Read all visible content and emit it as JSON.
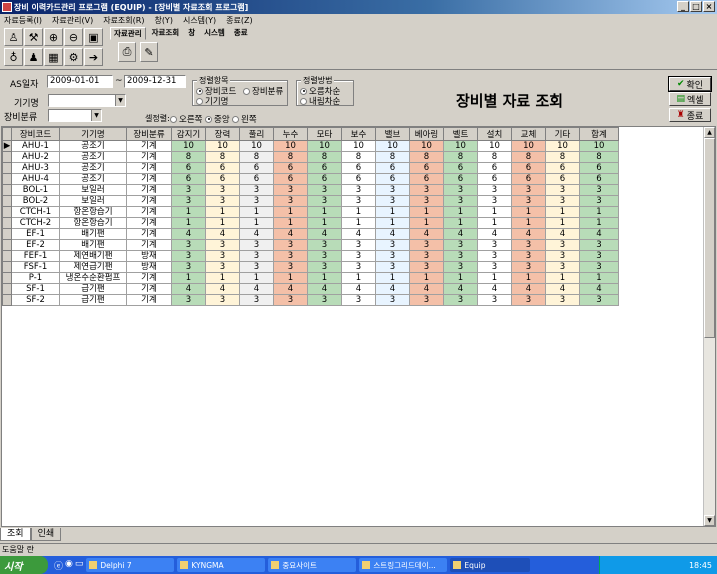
{
  "window": {
    "title": "장비 이력카드관리 프로그램 (EQUIP) - [장비별 자료조회 프로그램]"
  },
  "menu": [
    "자료등록(I)",
    "자료관리(V)",
    "자료조회(R)",
    "창(Y)",
    "시스템(Y)",
    "종료(Z)"
  ],
  "toolbar_tabs": [
    "자료관리",
    "자료조회",
    "창",
    "시스템",
    "종료"
  ],
  "filters": {
    "as_date_label": "AS일자",
    "date_from": "2009-01-01",
    "date_sep": "~",
    "date_to": "2009-12-31",
    "machine_name_label": "기기명",
    "machine_name_value": "",
    "category_label": "장비분류",
    "category_value": ""
  },
  "sort_item": {
    "title": "정렬항목",
    "options": [
      "장비코드",
      "장비분류",
      "기기명"
    ],
    "selected": "장비코드"
  },
  "sort_order": {
    "title": "정렬방법",
    "options": [
      "오름차순",
      "내림차순"
    ],
    "selected": "오름차순"
  },
  "alignment": {
    "label": "셀정렬:",
    "options": [
      "오른쪽",
      "중앙",
      "왼쪽"
    ],
    "selected": "중앙"
  },
  "page_title": "장비별 자료 조회",
  "buttons": {
    "confirm": "확인",
    "excel": "엑셀",
    "exit": "종료"
  },
  "table": {
    "columns": [
      "장비코드",
      "기기명",
      "장비분류",
      "감지기",
      "장력",
      "풀리",
      "누수",
      "모타",
      "보수",
      "밸브",
      "베아링",
      "벨트",
      "설치",
      "교체",
      "기타",
      "합계"
    ],
    "rows": [
      [
        "AHU-1",
        "공조기",
        "기계",
        "10",
        "10",
        "10",
        "10",
        "10",
        "10",
        "10",
        "10",
        "10",
        "10",
        "10",
        "10",
        "10"
      ],
      [
        "AHU-2",
        "공조기",
        "기계",
        "8",
        "8",
        "8",
        "8",
        "8",
        "8",
        "8",
        "8",
        "8",
        "8",
        "8",
        "8",
        "8"
      ],
      [
        "AHU-3",
        "공조기",
        "기계",
        "6",
        "6",
        "6",
        "6",
        "6",
        "6",
        "6",
        "6",
        "6",
        "6",
        "6",
        "6",
        "6"
      ],
      [
        "AHU-4",
        "공조기",
        "기계",
        "6",
        "6",
        "6",
        "6",
        "6",
        "6",
        "6",
        "6",
        "6",
        "6",
        "6",
        "6",
        "6"
      ],
      [
        "BOL-1",
        "보일러",
        "기계",
        "3",
        "3",
        "3",
        "3",
        "3",
        "3",
        "3",
        "3",
        "3",
        "3",
        "3",
        "3",
        "3"
      ],
      [
        "BOL-2",
        "보일러",
        "기계",
        "3",
        "3",
        "3",
        "3",
        "3",
        "3",
        "3",
        "3",
        "3",
        "3",
        "3",
        "3",
        "3"
      ],
      [
        "CTCH-1",
        "항온항습기",
        "기계",
        "1",
        "1",
        "1",
        "1",
        "1",
        "1",
        "1",
        "1",
        "1",
        "1",
        "1",
        "1",
        "1"
      ],
      [
        "CTCH-2",
        "항온항습기",
        "기계",
        "1",
        "1",
        "1",
        "1",
        "1",
        "1",
        "1",
        "1",
        "1",
        "1",
        "1",
        "1",
        "1"
      ],
      [
        "EF-1",
        "배기팬",
        "기계",
        "4",
        "4",
        "4",
        "4",
        "4",
        "4",
        "4",
        "4",
        "4",
        "4",
        "4",
        "4",
        "4"
      ],
      [
        "EF-2",
        "배기팬",
        "기계",
        "3",
        "3",
        "3",
        "3",
        "3",
        "3",
        "3",
        "3",
        "3",
        "3",
        "3",
        "3",
        "3"
      ],
      [
        "FEF-1",
        "제연배기팬",
        "방재",
        "3",
        "3",
        "3",
        "3",
        "3",
        "3",
        "3",
        "3",
        "3",
        "3",
        "3",
        "3",
        "3"
      ],
      [
        "FSF-1",
        "제연급기팬",
        "방재",
        "3",
        "3",
        "3",
        "3",
        "3",
        "3",
        "3",
        "3",
        "3",
        "3",
        "3",
        "3",
        "3"
      ],
      [
        "P-1",
        "냉온수순환펌프",
        "기계",
        "1",
        "1",
        "1",
        "1",
        "1",
        "1",
        "1",
        "1",
        "1",
        "1",
        "1",
        "1",
        "1"
      ],
      [
        "SF-1",
        "급기팬",
        "기계",
        "4",
        "4",
        "4",
        "4",
        "4",
        "4",
        "4",
        "4",
        "4",
        "4",
        "4",
        "4",
        "4"
      ],
      [
        "SF-2",
        "급기팬",
        "기계",
        "3",
        "3",
        "3",
        "3",
        "3",
        "3",
        "3",
        "3",
        "3",
        "3",
        "3",
        "3",
        "3"
      ]
    ],
    "column_colors": [
      "#ffffff",
      "#ffffff",
      "#ffffff",
      "#b8dcb8",
      "#fff4d8",
      "#f0f0f0",
      "#f4c0a8",
      "#b8dcb8",
      "#ffffff",
      "#e8f4ff",
      "#f4c0a8",
      "#b8dcb8",
      "#ffffff",
      "#f4c0a8",
      "#fff4d8",
      "#b8dcb8"
    ]
  },
  "bottom_tabs": [
    "조회",
    "인쇄"
  ],
  "status": "도움말 란",
  "taskbar": {
    "start": "시작",
    "tasks": [
      "Delphi 7",
      "KYNGMA",
      "중요사이트",
      "스트링그리드데이...",
      "Equip"
    ],
    "clock": "18:45"
  }
}
